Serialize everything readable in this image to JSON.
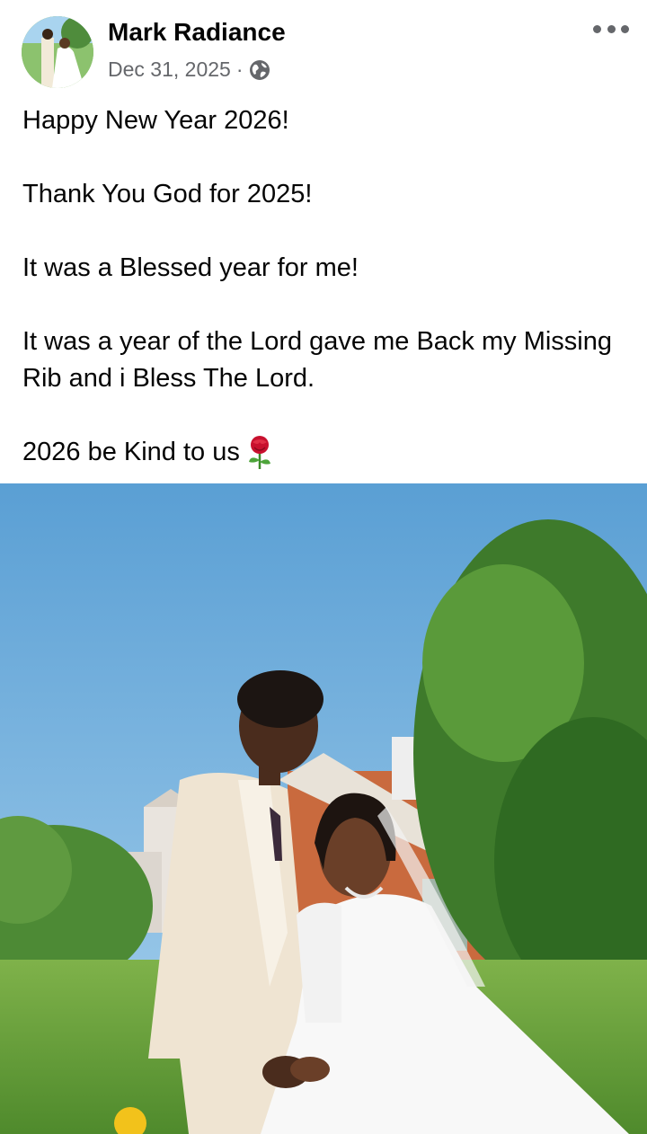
{
  "post": {
    "author": "Mark Radiance",
    "date": "Dec 31, 2025",
    "separator": "·",
    "privacy_icon": "globe-icon",
    "more_icon": "more-options-icon",
    "paragraphs": [
      "Happy New Year 2026!",
      "Thank You God for 2025!",
      "It was a Blessed year for me!",
      "It was a year of the Lord gave me Back my Missing Rib and i Bless The Lord.",
      "2026 be Kind to us"
    ],
    "trailing_emoji": "rose-emoji"
  },
  "colors": {
    "text": "#050505",
    "secondary": "#65676b",
    "sky": "#5fa3d6"
  }
}
